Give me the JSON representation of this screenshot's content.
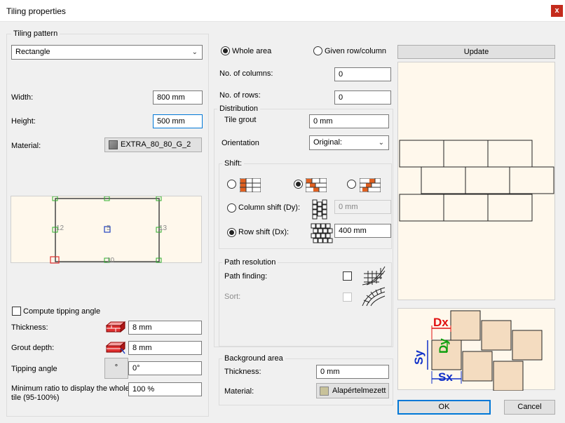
{
  "window": {
    "title": "Tiling properties",
    "close_label": "x"
  },
  "tiling_pattern": {
    "legend": "Tiling pattern",
    "pattern_value": "Rectangle",
    "width_label": "Width:",
    "width_value": "800 mm",
    "height_label": "Height:",
    "height_value": "500 mm",
    "material_label": "Material:",
    "material_value": "EXTRA_80_80_G_2",
    "preview_labels": [
      "12",
      "5",
      "13",
      "10"
    ],
    "compute_tipping_label": "Compute tipping angle",
    "thickness_label": "Thickness:",
    "thickness_value": "8 mm",
    "grout_depth_label": "Grout depth:",
    "grout_depth_value": "8 mm",
    "tipping_angle_label": "Tipping angle",
    "tipping_angle_value": "0°",
    "min_ratio_label": "Minimum ratio to display the whole tile (95-100%)",
    "min_ratio_value": "100 %"
  },
  "area": {
    "whole_area_label": "Whole area",
    "given_rowcol_label": "Given row/column",
    "columns_label": "No. of columns:",
    "columns_value": "0",
    "rows_label": "No. of rows:",
    "rows_value": "0"
  },
  "distribution": {
    "legend": "Distribution",
    "tile_grout_label": "Tile grout",
    "tile_grout_value": "0 mm",
    "orientation_label": "Orientation",
    "orientation_value": "Original:",
    "shift_legend": "Shift:",
    "column_shift_label": "Column shift (Dy):",
    "column_shift_value": "0 mm",
    "row_shift_label": "Row shift (Dx):",
    "row_shift_value": "400 mm"
  },
  "path_resolution": {
    "legend": "Path resolution",
    "path_finding_label": "Path finding:",
    "sort_label": "Sort:"
  },
  "background": {
    "legend": "Background area",
    "thickness_label": "Thickness:",
    "thickness_value": "0 mm",
    "material_label": "Material:",
    "material_value": "Alapértelmezett"
  },
  "preview": {
    "update_label": "Update",
    "diagram_labels": {
      "dx": "Dx",
      "dy": "Dy",
      "sx": "Sx",
      "sy": "Sy"
    }
  },
  "buttons": {
    "ok_label": "OK",
    "cancel_label": "Cancel"
  },
  "colors": {
    "accent": "#0078d7",
    "close": "#c42b1c",
    "canvas_bg": "#fff8ec",
    "tile_fill": "#f4dcc0",
    "diagram_red": "#e01010",
    "diagram_blue": "#1030c8",
    "diagram_green": "#10a010"
  },
  "icons": [
    "close-icon",
    "chevron-down-icon",
    "material-swatch-icon",
    "brick-stack-icon",
    "brick-shift-icon",
    "grid-icon",
    "path-icon",
    "tipping-angle-icon"
  ]
}
